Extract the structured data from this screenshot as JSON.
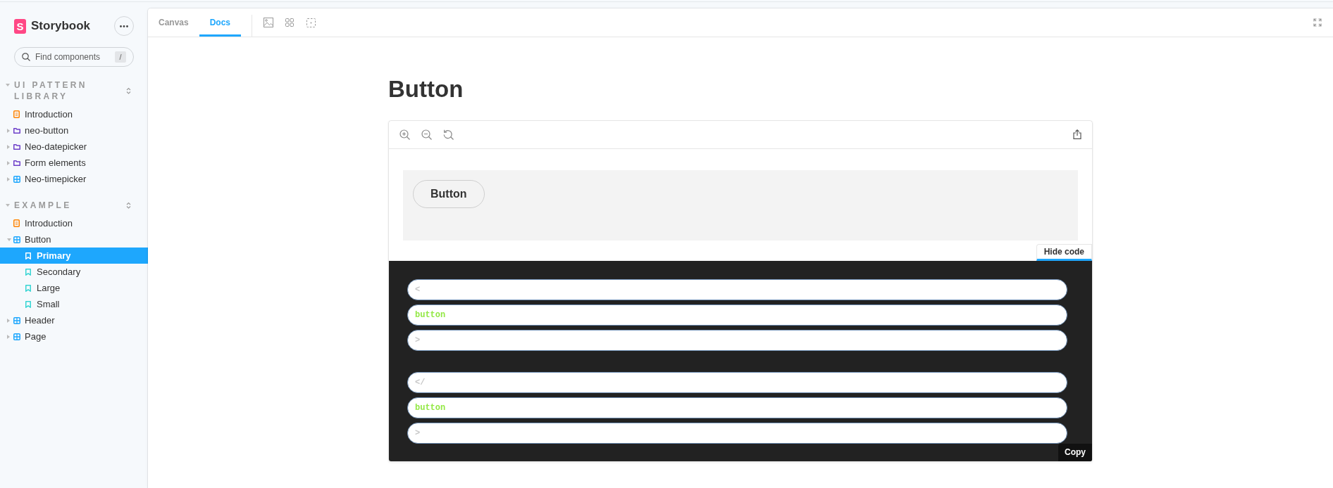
{
  "sidebar": {
    "brand": {
      "mark": "S",
      "name": "Storybook"
    },
    "search": {
      "placeholder": "Find components",
      "shortcut": "/"
    },
    "sections": [
      {
        "title": "UI PATTERN LIBRARY",
        "expanded": true,
        "items": [
          {
            "kind": "docs",
            "label": "Introduction",
            "selected": false
          },
          {
            "kind": "folder",
            "label": "neo-button",
            "expanded": false,
            "selected": false
          },
          {
            "kind": "folder",
            "label": "Neo-datepicker",
            "expanded": false,
            "selected": false
          },
          {
            "kind": "folder",
            "label": "Form elements",
            "expanded": false,
            "selected": false
          },
          {
            "kind": "component",
            "label": "Neo-timepicker",
            "expanded": false,
            "selected": false
          }
        ]
      },
      {
        "title": "EXAMPLE",
        "expanded": true,
        "items": [
          {
            "kind": "docs",
            "label": "Introduction",
            "selected": false
          },
          {
            "kind": "component",
            "label": "Button",
            "expanded": true,
            "selected": false,
            "children": [
              {
                "kind": "story",
                "label": "Primary",
                "selected": true
              },
              {
                "kind": "story",
                "label": "Secondary",
                "selected": false
              },
              {
                "kind": "story",
                "label": "Large",
                "selected": false
              },
              {
                "kind": "story",
                "label": "Small",
                "selected": false
              }
            ]
          },
          {
            "kind": "component",
            "label": "Header",
            "expanded": false,
            "selected": false
          },
          {
            "kind": "component",
            "label": "Page",
            "expanded": false,
            "selected": false
          }
        ]
      }
    ]
  },
  "toolbar": {
    "tabs": [
      {
        "label": "Canvas",
        "selected": false
      },
      {
        "label": "Docs",
        "selected": true
      }
    ]
  },
  "docs": {
    "title": "Button",
    "preview": {
      "button_label": "Button"
    },
    "code_toggle": "Hide code",
    "code": [
      {
        "tokens": [
          {
            "kind": "punctuation",
            "text": "<"
          },
          {
            "kind": "tag",
            "text": "button"
          },
          {
            "kind": "punctuation",
            "text": ">"
          }
        ]
      },
      {
        "tokens": [
          {
            "kind": "punctuation",
            "text": "</"
          },
          {
            "kind": "tag",
            "text": "button"
          },
          {
            "kind": "punctuation",
            "text": ">"
          }
        ]
      }
    ],
    "copy_label": "Copy"
  }
}
